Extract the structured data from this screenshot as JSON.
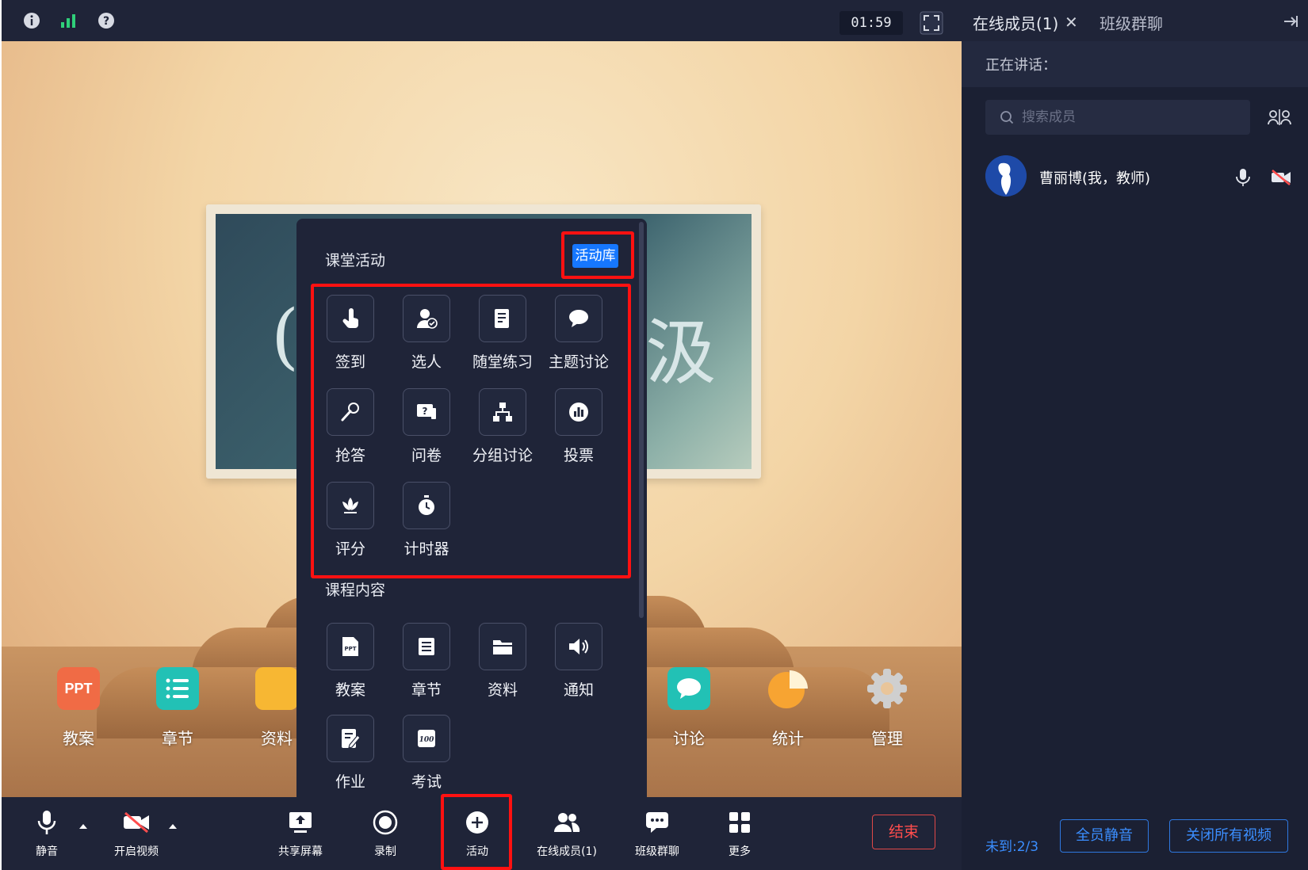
{
  "topbar": {
    "timer": "01:59",
    "icons": [
      "info-icon",
      "signal-icon",
      "help-icon",
      "fullscreen-icon"
    ]
  },
  "stage": {
    "board_text_left": "(",
    "board_text_right": "汲",
    "dock": [
      {
        "label": "教案",
        "icon": "ppt-icon",
        "color": "#f06b45"
      },
      {
        "label": "章节",
        "icon": "list-icon",
        "color": "#22c1b5"
      },
      {
        "label": "资料",
        "icon": "folder-icon",
        "color": "#f7b733"
      },
      {
        "label": "讨论",
        "icon": "chat-icon",
        "color": "#22c1b5"
      },
      {
        "label": "统计",
        "icon": "pie-icon",
        "color": "#f7a432"
      },
      {
        "label": "管理",
        "icon": "gear-icon",
        "color": "#c9c9c9"
      }
    ]
  },
  "popup": {
    "section_activities": "课堂活动",
    "library_button": "活动库",
    "activities": [
      "签到",
      "选人",
      "随堂练习",
      "主题讨论",
      "抢答",
      "问卷",
      "分组讨论",
      "投票",
      "评分",
      "计时器"
    ],
    "section_content": "课程内容",
    "content": [
      "教案",
      "章节",
      "资料",
      "通知",
      "作业",
      "考试"
    ]
  },
  "toolbar": {
    "mute": "静音",
    "video": "开启视频",
    "share": "共享屏幕",
    "record": "录制",
    "activity": "活动",
    "members": "在线成员(1)",
    "chat": "班级群聊",
    "more": "更多",
    "end": "结束"
  },
  "right_panel": {
    "tab_members": "在线成员(1)",
    "tab_chat": "班级群聊",
    "speaking": "正在讲话：",
    "search_placeholder": "搜索成员",
    "member_name": "曹丽博(我，教师)",
    "absent": "未到:2/3",
    "mute_all": "全员静音",
    "close_all_video": "关闭所有视频"
  },
  "colors": {
    "panel_bg": "#1f2438",
    "accent": "#1677ff",
    "highlight_outline": "#ff1111",
    "end_red": "#ff4d4d"
  }
}
